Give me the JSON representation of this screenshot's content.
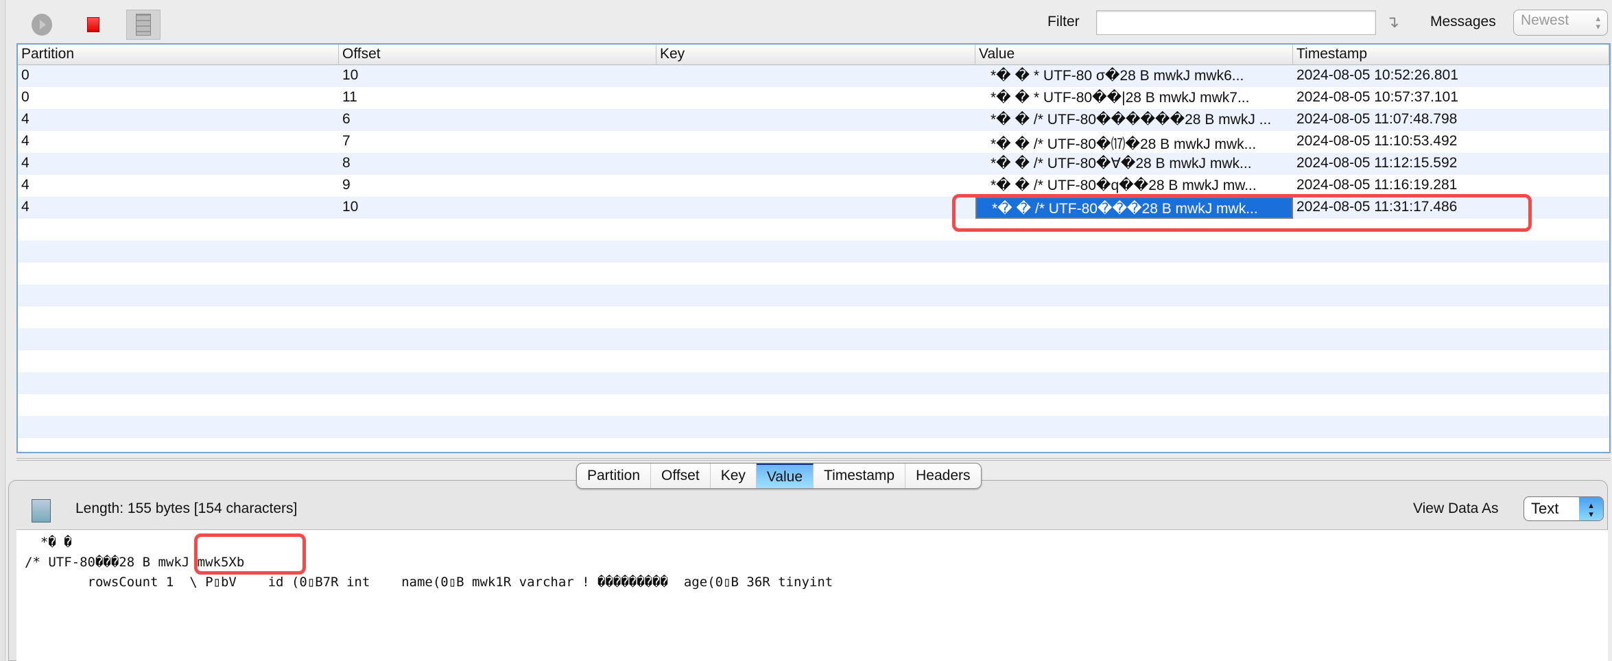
{
  "toolbar": {
    "filter_label": "Filter",
    "filter_value": "",
    "messages_label": "Messages",
    "messages_select": "Newest"
  },
  "table": {
    "columns": [
      "Partition",
      "Offset",
      "Key",
      "Value",
      "Timestamp"
    ],
    "rows": [
      {
        "partition": "0",
        "offset": "10",
        "key": "",
        "value": "*� �  * UTF-80   σ�28 B mwkJ mwk6...",
        "timestamp": "2024-08-05 10:52:26.801"
      },
      {
        "partition": "0",
        "offset": "11",
        "key": "",
        "value": "*� �  * UTF-80��|28 B mwkJ mwk7...",
        "timestamp": "2024-08-05 10:57:37.101"
      },
      {
        "partition": "4",
        "offset": "6",
        "key": "",
        "value": "*� � /* UTF-80������28 B mwkJ ...",
        "timestamp": "2024-08-05 11:07:48.798"
      },
      {
        "partition": "4",
        "offset": "7",
        "key": "",
        "value": "*� � /* UTF-80�⒄�28 B mwkJ mwk...",
        "timestamp": "2024-08-05 11:10:53.492"
      },
      {
        "partition": "4",
        "offset": "8",
        "key": "",
        "value": "*� � /* UTF-80�∀�28 B mwkJ mwk...",
        "timestamp": "2024-08-05 11:12:15.592"
      },
      {
        "partition": "4",
        "offset": "9",
        "key": "",
        "value": "*� � /* UTF-80�q��28 B mwkJ mw...",
        "timestamp": "2024-08-05 11:16:19.281"
      },
      {
        "partition": "4",
        "offset": "10",
        "key": "",
        "value": "*� � /* UTF-80���28 B mwkJ mwk...",
        "timestamp": "2024-08-05 11:31:17.486"
      }
    ]
  },
  "detail": {
    "tabs": [
      "Partition",
      "Offset",
      "Key",
      "Value",
      "Timestamp",
      "Headers"
    ],
    "active_tab": "Value",
    "length": "Length: 155 bytes [154 characters]",
    "view_as_label": "View Data As",
    "view_as_value": "Text",
    "content_lines": [
      "  *� �",
      "/* UTF-80���28 B mwkJ mwk5Xb",
      "        rowsCount 1  \\ P▯bV    id (0▯B7R int    name(0▯B mwk1R varchar ! ���������  age(0▯B 36R tinyint"
    ]
  },
  "colors": {
    "selection": "#1a6fd9",
    "highlight": "#f24b4b",
    "row_alt": "#edf3fe"
  }
}
